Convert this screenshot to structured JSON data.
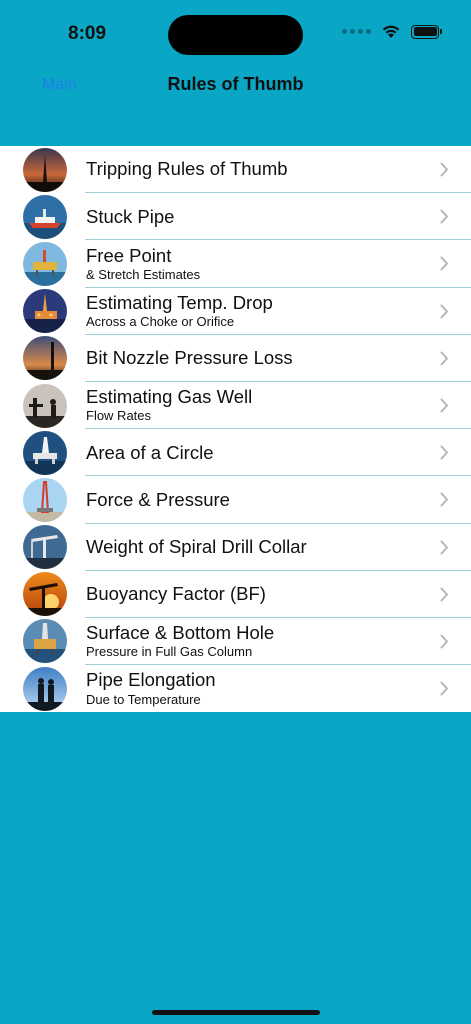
{
  "status_bar": {
    "time": "8:09"
  },
  "nav": {
    "back_label": "Main",
    "title": "Rules of Thumb"
  },
  "colors": {
    "background": "#0aa6c5",
    "accent": "#1f7ee8",
    "separator": "#9fd1d9"
  },
  "items": [
    {
      "title": "Tripping Rules of Thumb",
      "subtitle": "",
      "thumbnail": "oil-rig-sunset"
    },
    {
      "title": "Stuck Pipe",
      "subtitle": "",
      "thumbnail": "drillship"
    },
    {
      "title": "Free Point",
      "subtitle": "& Stretch Estimates",
      "thumbnail": "offshore-platform"
    },
    {
      "title": "Estimating Temp. Drop",
      "subtitle": "Across a Choke or Orifice",
      "thumbnail": "platform-night"
    },
    {
      "title": "Bit Nozzle Pressure Loss",
      "subtitle": "",
      "thumbnail": "rig-dusk"
    },
    {
      "title": "Estimating Gas Well",
      "subtitle": "Flow Rates",
      "thumbnail": "workers-silhouette"
    },
    {
      "title": "Area of a Circle",
      "subtitle": "",
      "thumbnail": "semisub-rig"
    },
    {
      "title": "Force & Pressure",
      "subtitle": "",
      "thumbnail": "land-rig"
    },
    {
      "title": "Weight of Spiral Drill Collar",
      "subtitle": "",
      "thumbnail": "pumpjack-blue"
    },
    {
      "title": "Buoyancy Factor (BF)",
      "subtitle": "",
      "thumbnail": "pumpjack-sunset"
    },
    {
      "title": "Surface & Bottom Hole",
      "subtitle": "Pressure in Full Gas Column",
      "thumbnail": "rig-sea"
    },
    {
      "title": "Pipe Elongation",
      "subtitle": "Due to Temperature",
      "thumbnail": "workers-sky"
    }
  ]
}
